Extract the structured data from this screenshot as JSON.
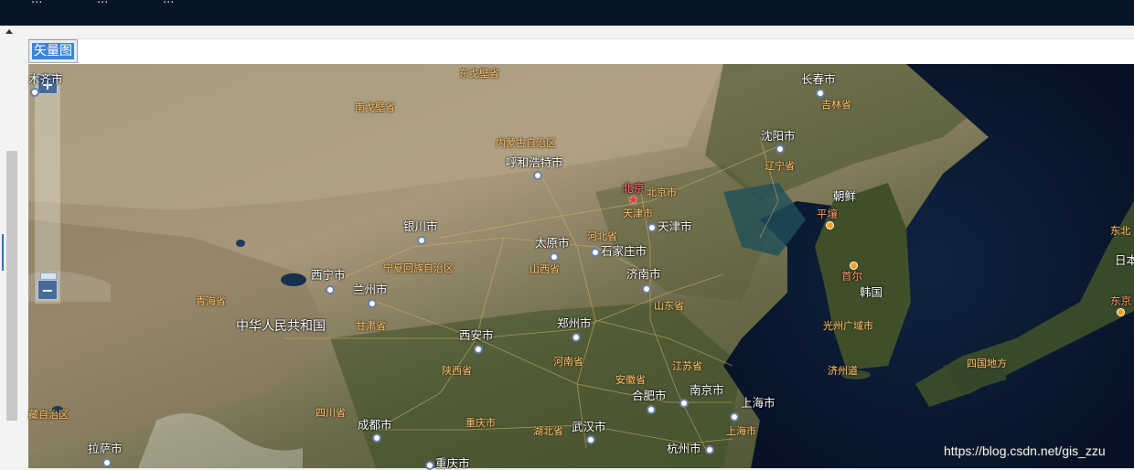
{
  "topbar": {
    "menu_items": [
      "...",
      "...",
      "..."
    ]
  },
  "toolbar": {
    "vector_button_label": "矢量图"
  },
  "map": {
    "zoom_in_label": "+",
    "zoom_out_label": "−",
    "country_labels": [
      {
        "text": "中华人民共和国"
      },
      {
        "text": "朝鲜"
      },
      {
        "text": "韩国"
      },
      {
        "text": "日本"
      }
    ],
    "city_labels": [
      {
        "text": "长春市"
      },
      {
        "text": "沈阳市"
      },
      {
        "text": "呼和浩特市"
      },
      {
        "text": "银川市"
      },
      {
        "text": "天津市"
      },
      {
        "text": "太原市"
      },
      {
        "text": "石家庄市"
      },
      {
        "text": "济南市"
      },
      {
        "text": "西宁市"
      },
      {
        "text": "兰州市"
      },
      {
        "text": "郑州市"
      },
      {
        "text": "西安市"
      },
      {
        "text": "合肥市"
      },
      {
        "text": "南京市"
      },
      {
        "text": "上海市"
      },
      {
        "text": "成都市"
      },
      {
        "text": "武汉市"
      },
      {
        "text": "杭州市"
      },
      {
        "text": "重庆市"
      },
      {
        "text": "拉萨市"
      },
      {
        "text": "木齐市"
      }
    ],
    "province_labels": [
      {
        "text": "东戈壁省"
      },
      {
        "text": "南戈壁省"
      },
      {
        "text": "内蒙古自治区"
      },
      {
        "text": "吉林省"
      },
      {
        "text": "辽宁省"
      },
      {
        "text": "北京市"
      },
      {
        "text": "天津市"
      },
      {
        "text": "河北省"
      },
      {
        "text": "山西省"
      },
      {
        "text": "宁夏回族自治区"
      },
      {
        "text": "青海省"
      },
      {
        "text": "甘肃省"
      },
      {
        "text": "山东省"
      },
      {
        "text": "河南省"
      },
      {
        "text": "陕西省"
      },
      {
        "text": "安徽省"
      },
      {
        "text": "江苏省"
      },
      {
        "text": "四川省"
      },
      {
        "text": "重庆市"
      },
      {
        "text": "湖北省"
      },
      {
        "text": "上海市"
      },
      {
        "text": "藏自治区"
      }
    ],
    "korea_japan_labels": [
      {
        "text": "平壤"
      },
      {
        "text": "首尔"
      },
      {
        "text": "光州广域市"
      },
      {
        "text": "济州道"
      },
      {
        "text": "四国地方"
      },
      {
        "text": "东北"
      },
      {
        "text": "东京"
      }
    ],
    "capital_label": "北京",
    "watermark": "https://blog.csdn.net/gis_zzu"
  }
}
